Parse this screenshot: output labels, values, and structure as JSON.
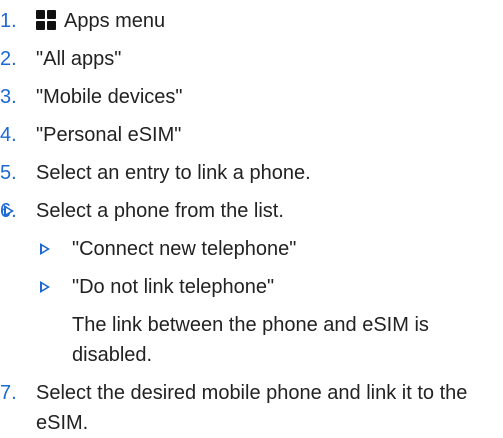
{
  "steps": [
    {
      "num": "1.",
      "icon": "apps-grid-icon",
      "text": "Apps menu"
    },
    {
      "num": "2.",
      "text": "\"All apps\""
    },
    {
      "num": "3.",
      "text": "\"Mobile devices\""
    },
    {
      "num": "4.",
      "text": "\"Personal eSIM\""
    },
    {
      "num": "5.",
      "text": "Select an entry to link a phone."
    },
    {
      "num": "6.",
      "options": [
        "Select a phone from the list.",
        "\"Connect new telephone\"",
        "\"Do not link telephone\""
      ],
      "note": "The link between the phone and eSIM is disabled."
    },
    {
      "num": "7.",
      "text": "Select the desired mobile phone and link it to the eSIM."
    }
  ],
  "colors": {
    "accent": "#1c69d4",
    "text": "#222222",
    "icon": "#111111"
  }
}
